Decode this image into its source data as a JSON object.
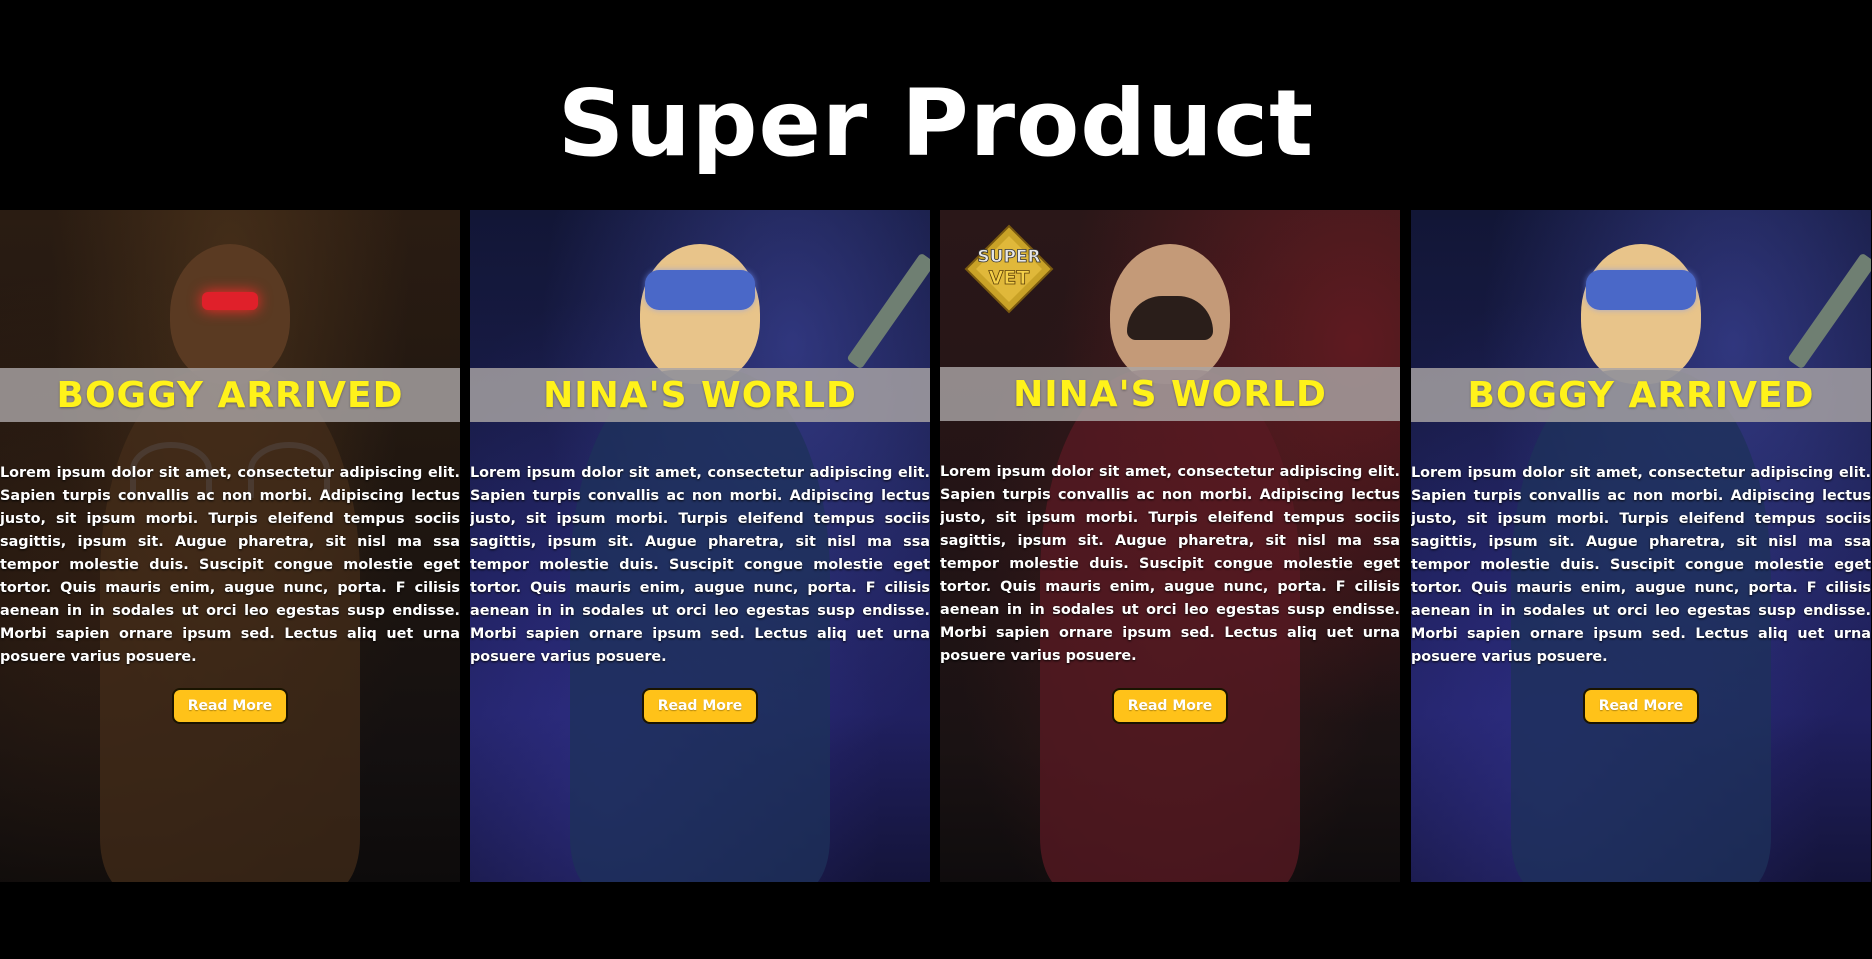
{
  "page": {
    "title": "Super Product",
    "background": "#000000"
  },
  "colors": {
    "card_title": "#fff21a",
    "banner": "#aaa5a5",
    "button": "#ffc219",
    "button_text": "#ffffff"
  },
  "cards": [
    {
      "title": "BOGGY ARRIVED",
      "character": "boggy",
      "text": "Lorem ipsum dolor sit amet, consectetur adipiscing elit. Sapien turpis convallis ac non morbi. Adipiscing lectus justo, sit ipsum morbi. Turpis eleifend tempus sociis sagittis, ipsum sit. Augue pharetra, sit nisl ma ssa tempor molestie duis. Suscipit congue molestie eget tortor. Quis mauris enim, augue nunc, porta. F cilisis aenean in in sodales ut orci leo egestas susp endisse. Morbi sapien ornare ipsum sed. Lectus aliq uet urna posuere varius posuere.",
      "button_label": "Read More"
    },
    {
      "title": "NINA'S WORLD",
      "character": "nina",
      "text": "Lorem ipsum dolor sit amet, consectetur adipiscing elit. Sapien turpis convallis ac non morbi. Adipiscing lectus justo, sit ipsum morbi. Turpis eleifend tempus sociis sagittis, ipsum sit. Augue pharetra, sit nisl ma ssa tempor molestie duis. Suscipit congue molestie eget tortor. Quis mauris enim, augue nunc, porta. F cilisis aenean in in sodales ut orci leo egestas susp endisse. Morbi sapien ornare ipsum sed. Lectus aliq uet urna posuere varius posuere.",
      "button_label": "Read More"
    },
    {
      "title": "NINA'S WORLD",
      "character": "super-vet",
      "logo_text": [
        "SUPER",
        "VET"
      ],
      "text": "Lorem ipsum dolor sit amet, consectetur adipiscing elit. Sapien turpis convallis ac non morbi. Adipiscing lectus justo, sit ipsum morbi. Turpis eleifend tempus sociis sagittis, ipsum sit. Augue pharetra, sit nisl ma ssa tempor molestie duis. Suscipit congue molestie eget tortor. Quis mauris enim, augue nunc, porta. F cilisis aenean in in sodales ut orci leo egestas susp endisse. Morbi sapien ornare ipsum sed. Lectus aliq uet urna posuere varius posuere.",
      "button_label": "Read More"
    },
    {
      "title": "BOGGY ARRIVED",
      "character": "nina",
      "text": "Lorem ipsum dolor sit amet, consectetur adipiscing elit. Sapien turpis convallis ac non morbi. Adipiscing lectus justo, sit ipsum morbi. Turpis eleifend tempus sociis sagittis, ipsum sit. Augue pharetra, sit nisl ma ssa tempor molestie duis. Suscipit congue molestie eget tortor. Quis mauris enim, augue nunc, porta. F cilisis aenean in in sodales ut orci leo egestas susp endisse. Morbi sapien ornare ipsum sed. Lectus aliq uet urna posuere varius posuere.",
      "button_label": "Read More"
    }
  ]
}
